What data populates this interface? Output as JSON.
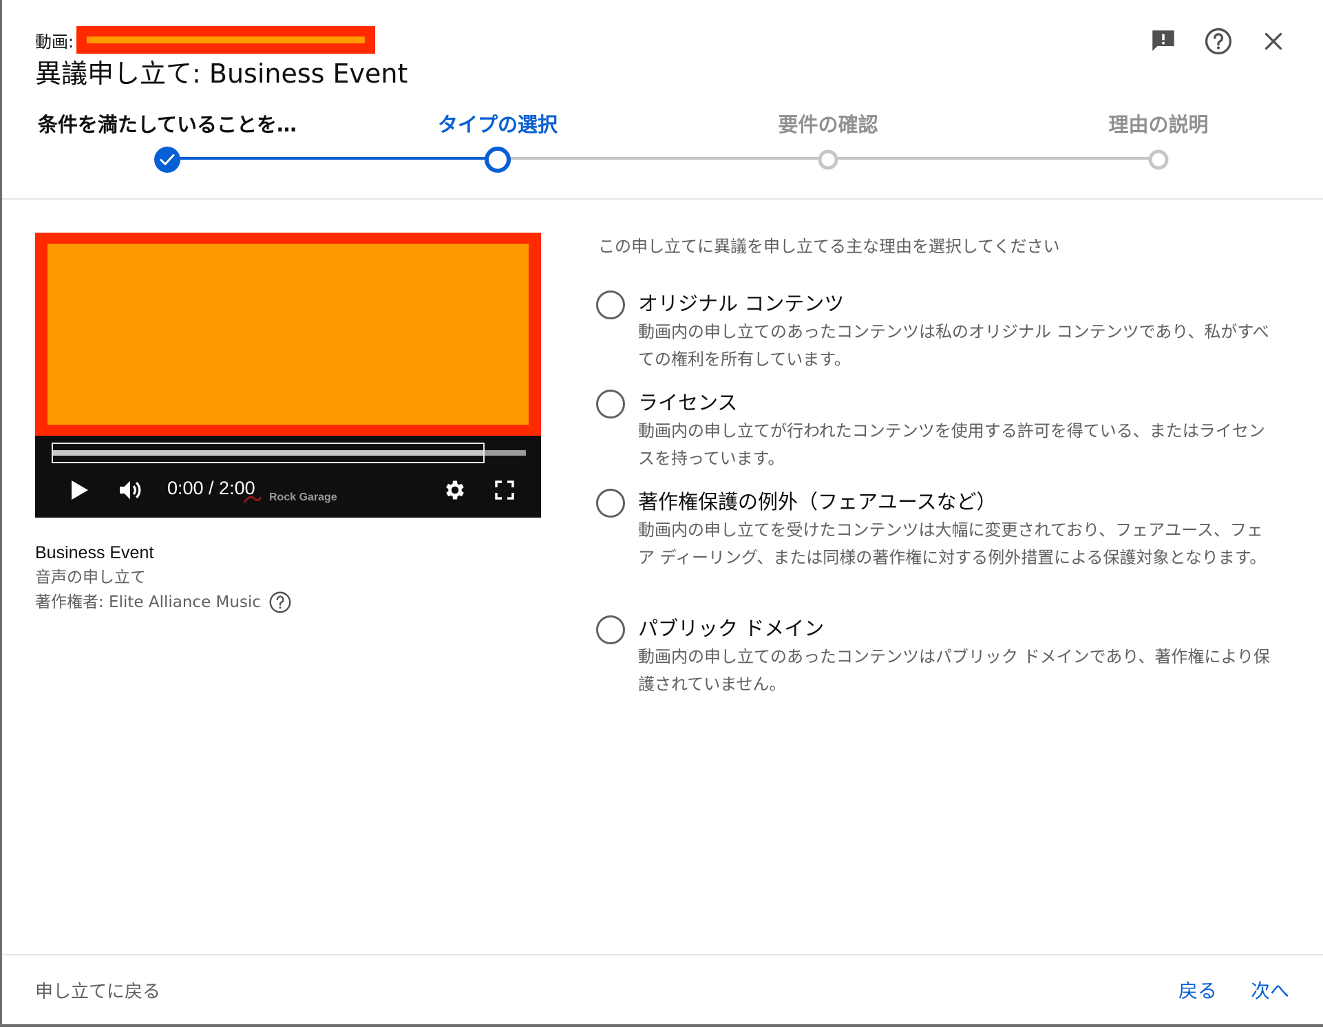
{
  "header": {
    "video_prefix": "動画:",
    "title": "異議申し立て: Business Event",
    "icons": [
      "feedback-icon",
      "help-icon",
      "close-icon"
    ]
  },
  "stepper": {
    "steps": [
      {
        "label": "条件を満たしていることを…",
        "state": "done"
      },
      {
        "label": "タイプの選択",
        "state": "active"
      },
      {
        "label": "要件の確認",
        "state": "todo"
      },
      {
        "label": "理由の説明",
        "state": "todo"
      }
    ],
    "colors": {
      "active": "#065fd4",
      "todo": "#c6c6c6"
    }
  },
  "player": {
    "time": "0:00 / 2:00",
    "watermark": "Rock Garage",
    "icons": [
      "play-icon",
      "volume-icon",
      "settings-icon",
      "fullscreen-icon"
    ]
  },
  "video_info": {
    "title": "Business Event",
    "claim_type": "音声の申し立て",
    "owner": "著作権者: Elite Alliance Music"
  },
  "options": {
    "prompt": "この申し立てに異議を申し立てる主な理由を選択してください",
    "items": [
      {
        "title": "オリジナル コンテンツ",
        "desc": "動画内の申し立てのあったコンテンツは私のオリジナル コンテンツであり、私がすべての権利を所有しています。"
      },
      {
        "title": "ライセンス",
        "desc": "動画内の申し立てが行われたコンテンツを使用する許可を得ている、またはライセンスを持っています。"
      },
      {
        "title": "著作権保護の例外（フェアユースなど）",
        "desc": "動画内の申し立てを受けたコンテンツは大幅に変更されており、フェアユース、フェア ディーリング、または同様の著作権に対する例外措置による保護対象となります。"
      },
      {
        "title": "パブリック ドメイン",
        "desc": "動画内の申し立てのあったコンテンツはパブリック ドメインであり、著作権により保護されていません。"
      }
    ]
  },
  "footer": {
    "back_to_claims": "申し立てに戻る",
    "back": "戻る",
    "next": "次へ"
  }
}
